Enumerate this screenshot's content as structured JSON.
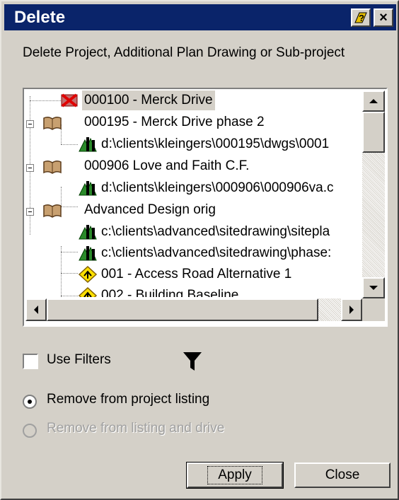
{
  "window": {
    "title": "Delete",
    "help_glyph": "?",
    "close_glyph": "×",
    "subtitle": "Delete Project, Additional Plan Drawing or Sub-project"
  },
  "tree": {
    "rows": [
      {
        "label": "000100 - Merck Drive",
        "icon": "project-deleted-icon",
        "selected": true
      },
      {
        "label": "000195 - Merck Drive phase 2",
        "icon": "project-book-icon"
      },
      {
        "label": "d:\\clients\\kleingers\\000195\\dwgs\\0001",
        "icon": "plan-drawing-icon"
      },
      {
        "label": "000906 Love and Faith C.F.",
        "icon": "project-book-icon"
      },
      {
        "label": "d:\\clients\\kleingers\\000906\\000906va.c",
        "icon": "plan-drawing-icon"
      },
      {
        "label": "Advanced Design orig",
        "icon": "project-book-icon"
      },
      {
        "label": "c:\\clients\\advanced\\sitedrawing\\sitepla",
        "icon": "plan-drawing-icon"
      },
      {
        "label": "c:\\clients\\advanced\\sitedrawing\\phase:",
        "icon": "plan-drawing-icon"
      },
      {
        "label": "001 - Access Road Alternative 1",
        "icon": "subproject-diamond-icon"
      },
      {
        "label": "002 - Building Baseline",
        "icon": "subproject-diamond-icon"
      }
    ]
  },
  "filters": {
    "checkbox_label": "Use Filters",
    "checked": false,
    "icon": "funnel-icon"
  },
  "options": {
    "remove_listing": "Remove from project listing",
    "remove_drive": "Remove from listing and drive",
    "selected": "remove_listing"
  },
  "buttons": {
    "apply": "Apply",
    "close": "Close"
  }
}
